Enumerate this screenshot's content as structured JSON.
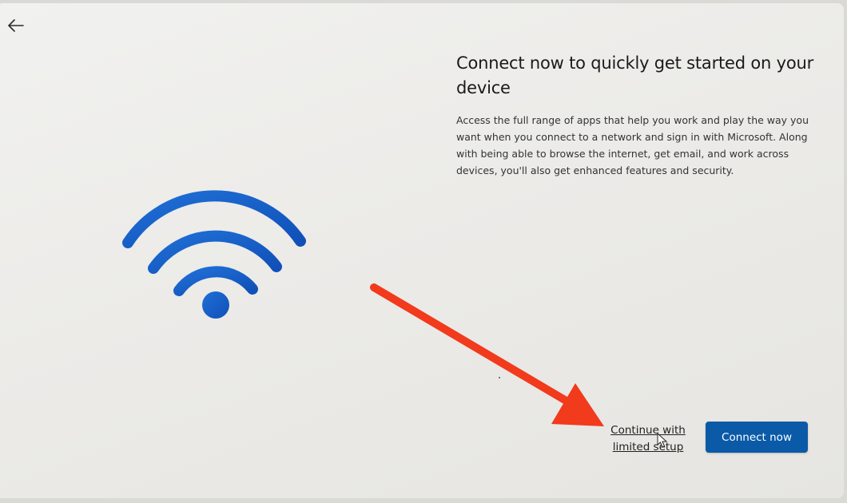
{
  "navigation": {
    "back_icon": "arrow-left-icon"
  },
  "illustration": {
    "icon": "wifi-icon",
    "color": "#1a5fc7"
  },
  "page": {
    "title": "Connect now to quickly get started on your device",
    "description": "Access the full range of apps that help you work and play the way you want when you connect to a network and sign in with Microsoft. Along with being able to browse the internet, get email, and work across devices, you'll also get enhanced features and security."
  },
  "actions": {
    "limited_setup_label": "Continue with limited setup",
    "connect_label": "Connect now"
  },
  "annotation": {
    "arrow_icon": "arrow-annotation-icon",
    "arrow_color": "#f23a1c"
  },
  "colors": {
    "accent": "#0a5aa8",
    "background": "#ecebe8"
  }
}
